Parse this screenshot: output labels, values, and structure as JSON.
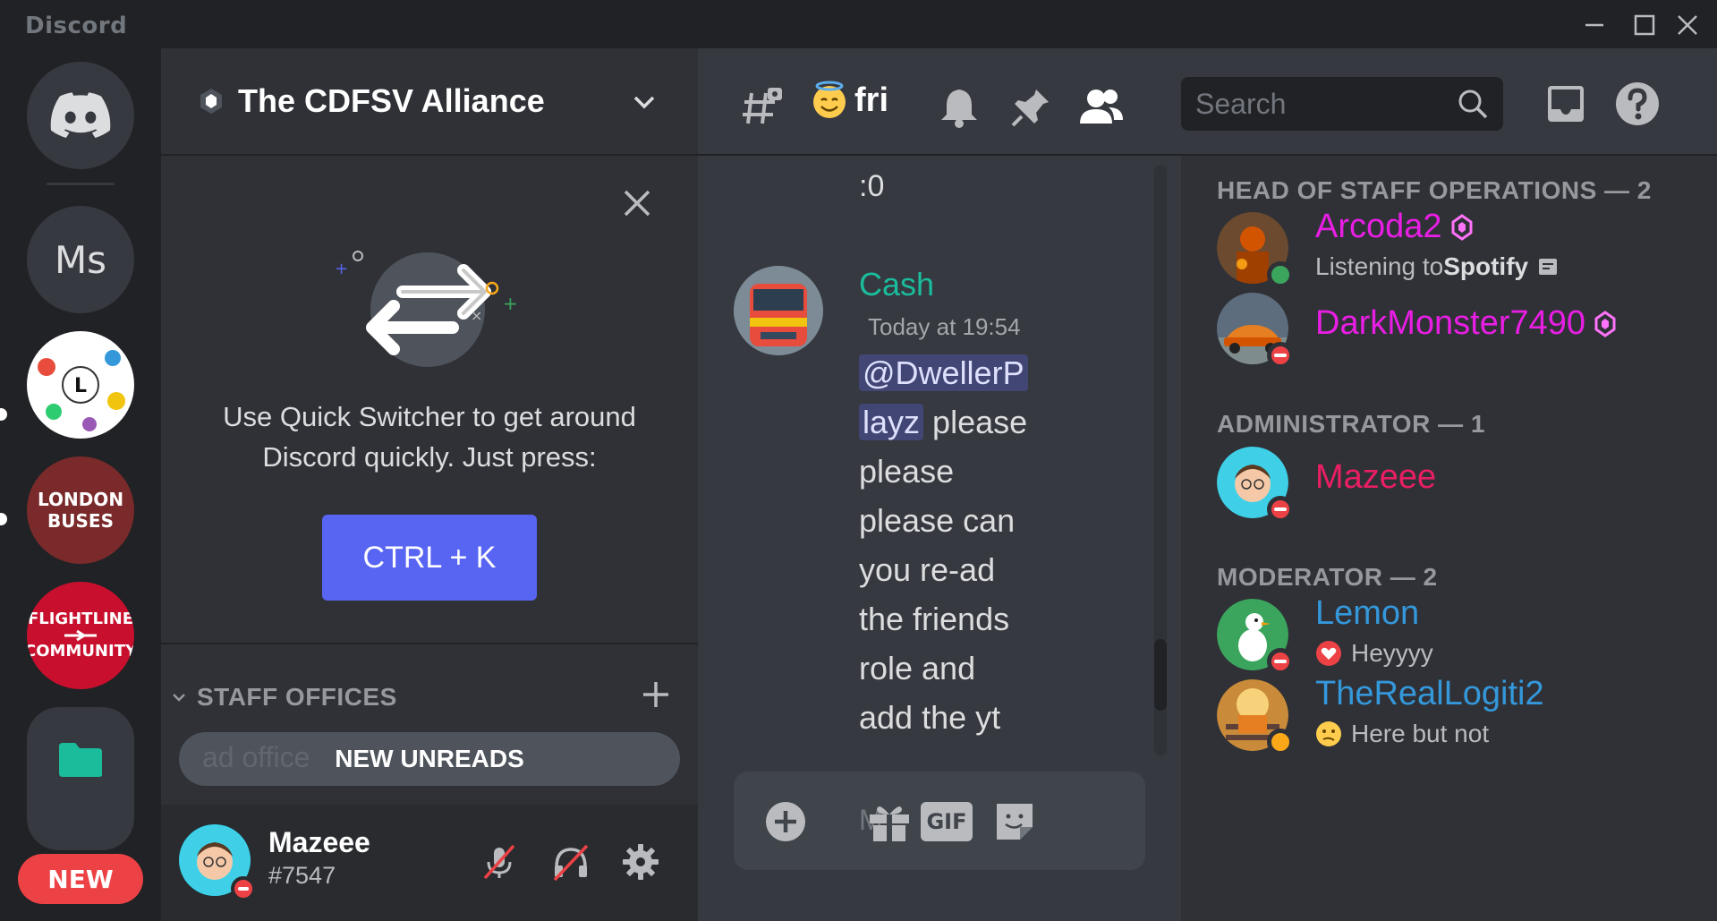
{
  "titlebar": {
    "app_name": "Discord"
  },
  "servers": {
    "home_label": "Home",
    "ms_label": "Ms",
    "london_line1": "LONDON",
    "london_line2": "BUSES",
    "flight_line1": "FLIGHTLINE",
    "flight_line2": "COMMUNITY",
    "new_badge": "NEW"
  },
  "channel_panel": {
    "server_name": "The CDFSV Alliance",
    "quick_switcher_text": "Use Quick Switcher to get around Discord quickly. Just press:",
    "quick_switcher_shortcut": "CTRL + K",
    "category_name": "STAFF OFFICES",
    "unreads_ghost": "ad          office",
    "unreads_label": "NEW UNREADS"
  },
  "user": {
    "name": "Mazeee",
    "tag": "#7547"
  },
  "chat": {
    "channel_name": "fri",
    "previous_message": ":0",
    "message": {
      "author": "Cash",
      "timestamp": "Today at 19:54",
      "mention_part1": "@DwellerP",
      "mention_part2": "layz",
      "text_after_mention": "please",
      "lines": [
        "please",
        "please can",
        "you re-ad",
        "the friends",
        "role and",
        "add the yt"
      ]
    },
    "composer_placeholder": "M",
    "gif_label": "GIF"
  },
  "search": {
    "placeholder": "Search"
  },
  "members": {
    "roles": [
      {
        "title": "HEAD OF STAFF OPERATIONS — 2"
      },
      {
        "title": "ADMINISTRATOR — 1"
      },
      {
        "title": "MODERATOR — 2"
      }
    ],
    "list": [
      {
        "name": "Arcoda2",
        "activity_prefix": "Listening to ",
        "activity_bold": "Spotify",
        "color": "#e91ee4",
        "status": "online"
      },
      {
        "name": "DarkMonster7490",
        "activity_prefix": "",
        "activity_bold": "",
        "color": "#e91ee4",
        "status": "dnd"
      },
      {
        "name": "Mazeee",
        "activity_prefix": "",
        "activity_bold": "",
        "color": "#e91e63",
        "status": "dnd"
      },
      {
        "name": "Lemon",
        "activity_prefix": "Heyyyy",
        "activity_bold": "",
        "color": "#3498db",
        "status": "dnd"
      },
      {
        "name": "TheRealLogiti2",
        "activity_prefix": "Here but not",
        "activity_bold": "",
        "color": "#3498db",
        "status": "idle"
      }
    ]
  },
  "colors": {
    "blurple": "#5865f2",
    "dnd": "#ed4245",
    "online": "#3ba55d",
    "idle": "#faa81a",
    "author_teal": "#1abc9c"
  },
  "icons": [
    "discord-logo-icon",
    "close-icon",
    "chevron-down-icon",
    "plus-icon",
    "mic-muted-icon",
    "headphones-muted-icon",
    "gear-icon",
    "threads-icon",
    "bell-icon",
    "pin-icon",
    "members-icon",
    "search-icon",
    "inbox-icon",
    "help-icon",
    "add-attachment-icon",
    "gift-icon",
    "sticker-icon",
    "nitro-boost-icon",
    "spotify-icon"
  ]
}
